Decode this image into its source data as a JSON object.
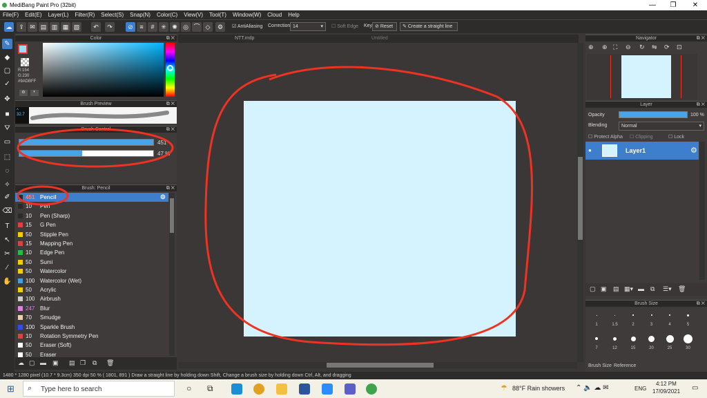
{
  "app": {
    "title": "MediBang Paint Pro (32bit)"
  },
  "window_controls": {
    "minimize": "—",
    "maximize": "❐",
    "close": "✕"
  },
  "menu": [
    "File(F)",
    "Edit(E)",
    "Layer(L)",
    "Filter(R)",
    "Select(S)",
    "Snap(N)",
    "Color(C)",
    "View(V)",
    "Tool(T)",
    "Window(W)",
    "Cloud",
    "Help"
  ],
  "toolbar": {
    "antialiasing_label": "AntiAliasing",
    "correction_label": "Correction",
    "correction_value": "14",
    "soft_edge_label": "Soft Edge",
    "key_label": "Key",
    "reset_label": "Reset",
    "straight_line_label": "Create a straight line"
  },
  "color_panel": {
    "title": "Color",
    "r": "R:154",
    "g": "G:230",
    "hex": "#9ADBFF",
    "fg_color": "#9adbff"
  },
  "brush_preview": {
    "title": "Brush Preview",
    "size": "32.7"
  },
  "brush_control": {
    "title": "Brush Control",
    "size_value": "451",
    "opacity_value": "47 %",
    "opacity_fraction": 0.47
  },
  "brush_list": {
    "title": "Brush: Pencil",
    "items": [
      {
        "size": "451",
        "name": "Pencil",
        "color": "#2a2a2a"
      },
      {
        "size": "10",
        "name": "Pen",
        "color": "#2a2a2a"
      },
      {
        "size": "10",
        "name": "Pen (Sharp)",
        "color": "#2a2a2a"
      },
      {
        "size": "15",
        "name": "G Pen",
        "color": "#e04040"
      },
      {
        "size": "50",
        "name": "Stipple Pen",
        "color": "#f0d000"
      },
      {
        "size": "15",
        "name": "Mapping Pen",
        "color": "#e04040"
      },
      {
        "size": "10",
        "name": "Edge Pen",
        "color": "#20c040"
      },
      {
        "size": "50",
        "name": "Sumi",
        "color": "#f0d000"
      },
      {
        "size": "50",
        "name": "Watercolor",
        "color": "#f0d000"
      },
      {
        "size": "100",
        "name": "Watercolor (Wet)",
        "color": "#40a0e0"
      },
      {
        "size": "50",
        "name": "Acrylic",
        "color": "#f0d000"
      },
      {
        "size": "100",
        "name": "Airbrush",
        "color": "#cccccc"
      },
      {
        "size": "247",
        "name": "Blur",
        "color": "#e080e0"
      },
      {
        "size": "70",
        "name": "Smudge",
        "color": "#e8d0b0"
      },
      {
        "size": "100",
        "name": "Sparkle Brush",
        "color": "#3050e0"
      },
      {
        "size": "10",
        "name": "Rotation Symmetry Pen",
        "color": "#e04040"
      },
      {
        "size": "50",
        "name": "Eraser (Soft)",
        "color": "#ffffff"
      },
      {
        "size": "50",
        "name": "Eraser",
        "color": "#ffffff"
      }
    ]
  },
  "tabs": {
    "file1": "NTT.mdp",
    "file2": "Untitled"
  },
  "navigator": {
    "title": "Navigator"
  },
  "layer_panel": {
    "title": "Layer",
    "opacity_label": "Opacity",
    "opacity_value": "100 %",
    "blending_label": "Blending",
    "blending_value": "Normal",
    "protect_alpha": "Protect Alpha",
    "clipping": "Clipping",
    "lock": "Lock",
    "layer_name": "Layer1"
  },
  "brush_size_panel": {
    "title": "Brush Size",
    "row1": [
      "1",
      "1.5",
      "2",
      "3",
      "4",
      "5"
    ],
    "row2": [
      "7",
      "12",
      "15",
      "20",
      "25",
      "30"
    ],
    "tab1": "Brush Size",
    "tab2": "Reference"
  },
  "status": {
    "text": "1480 * 1280 pixel   (10.7 * 9.3cm)   350 dpi   50 %   ( 1801, 891 )   Draw a straight line by holding down Shift, Change a brush size by holding down Ctrl, Alt, and dragging"
  },
  "taskbar": {
    "search_placeholder": "Type here to search",
    "weather": "88°F  Rain showers",
    "lang": "ENG",
    "time": "4:12 PM",
    "date": "17/09/2021"
  }
}
